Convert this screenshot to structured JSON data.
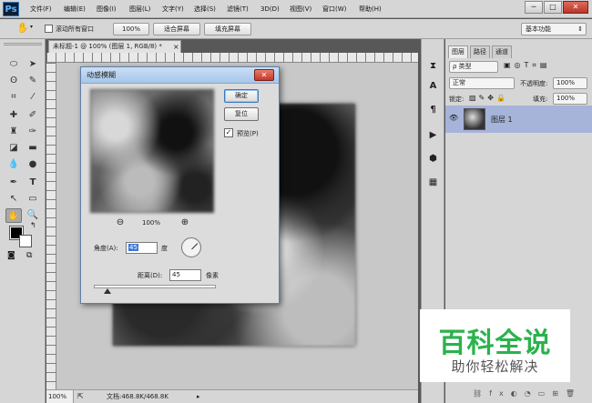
{
  "app": {
    "logo": "Ps"
  },
  "menu": [
    "文件(F)",
    "编辑(E)",
    "图像(I)",
    "图层(L)",
    "文字(Y)",
    "选择(S)",
    "滤镜(T)",
    "3D(D)",
    "视图(V)",
    "窗口(W)",
    "帮助(H)"
  ],
  "window_controls": {
    "minimize": "─",
    "restore": "□",
    "close": "✕"
  },
  "options_bar": {
    "hand_tool_icon": "✋",
    "scroll_all_label": "滚动所有窗口",
    "zoom_100": "100%",
    "fit_screen": "适合屏幕",
    "fill_screen": "填充屏幕",
    "workspace": "基本功能",
    "workspace_arrow": "⇕"
  },
  "document": {
    "tab_title": "未标题-1 @ 100% (图层 1, RGB/8) *",
    "tab_close": "×"
  },
  "status_bar": {
    "zoom": "100%",
    "doc_info": "文档:468.8K/468.8K"
  },
  "layers_panel": {
    "tabs": [
      "图层",
      "路径",
      "通道"
    ],
    "kind_filter": "ρ 类型",
    "blend_mode": "正常",
    "opacity_label": "不透明度:",
    "opacity_value": "100%",
    "lock_label": "锁定:",
    "fill_label": "填充:",
    "fill_value": "100%",
    "layer_name": "图层 1",
    "eye_icon": "👁"
  },
  "dialog": {
    "title": "动感模糊",
    "close": "✕",
    "ok": "确定",
    "reset": "复位",
    "preview_label": "预览(P)",
    "preview_checked": "✓",
    "zoom_out_icon": "⊖",
    "zoom_in_icon": "⊕",
    "zoom_level": "100%",
    "angle_label": "角度(A):",
    "angle_value": "45",
    "angle_unit": "度",
    "distance_label": "距离(D):",
    "distance_value": "45",
    "distance_unit": "像素"
  },
  "watermark": {
    "title": "百科全说",
    "subtitle": "助你轻松解决"
  }
}
